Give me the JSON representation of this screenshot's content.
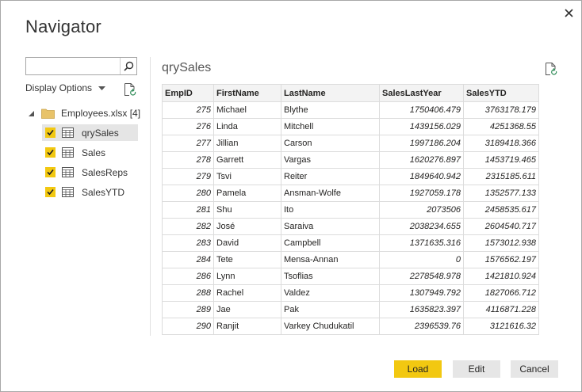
{
  "dialog": {
    "title": "Navigator"
  },
  "search": {
    "value": "",
    "placeholder": ""
  },
  "display_options": {
    "label": "Display Options"
  },
  "tree": {
    "root_label": "Employees.xlsx [4]",
    "items": [
      {
        "label": "qrySales",
        "checked": true,
        "selected": true
      },
      {
        "label": "Sales",
        "checked": true,
        "selected": false
      },
      {
        "label": "SalesReps",
        "checked": true,
        "selected": false
      },
      {
        "label": "SalesYTD",
        "checked": true,
        "selected": false
      }
    ]
  },
  "preview": {
    "title": "qrySales",
    "columns": [
      "EmpID",
      "FirstName",
      "LastName",
      "SalesLastYear",
      "SalesYTD"
    ],
    "rows": [
      [
        "275",
        "Michael",
        "Blythe",
        "1750406.479",
        "3763178.179"
      ],
      [
        "276",
        "Linda",
        "Mitchell",
        "1439156.029",
        "4251368.55"
      ],
      [
        "277",
        "Jillian",
        "Carson",
        "1997186.204",
        "3189418.366"
      ],
      [
        "278",
        "Garrett",
        "Vargas",
        "1620276.897",
        "1453719.465"
      ],
      [
        "279",
        "Tsvi",
        "Reiter",
        "1849640.942",
        "2315185.611"
      ],
      [
        "280",
        "Pamela",
        "Ansman-Wolfe",
        "1927059.178",
        "1352577.133"
      ],
      [
        "281",
        "Shu",
        "Ito",
        "2073506",
        "2458535.617"
      ],
      [
        "282",
        "José",
        "Saraiva",
        "2038234.655",
        "2604540.717"
      ],
      [
        "283",
        "David",
        "Campbell",
        "1371635.316",
        "1573012.938"
      ],
      [
        "284",
        "Tete",
        "Mensa-Annan",
        "0",
        "1576562.197"
      ],
      [
        "286",
        "Lynn",
        "Tsoflias",
        "2278548.978",
        "1421810.924"
      ],
      [
        "288",
        "Rachel",
        "Valdez",
        "1307949.792",
        "1827066.712"
      ],
      [
        "289",
        "Jae",
        "Pak",
        "1635823.397",
        "4116871.228"
      ],
      [
        "290",
        "Ranjit",
        "Varkey Chudukatil",
        "2396539.76",
        "3121616.32"
      ]
    ]
  },
  "buttons": {
    "load": "Load",
    "edit": "Edit",
    "cancel": "Cancel"
  },
  "colors": {
    "accent": "#f2c811",
    "checkbox": "#f2c811",
    "folder": "#e8c36a"
  }
}
